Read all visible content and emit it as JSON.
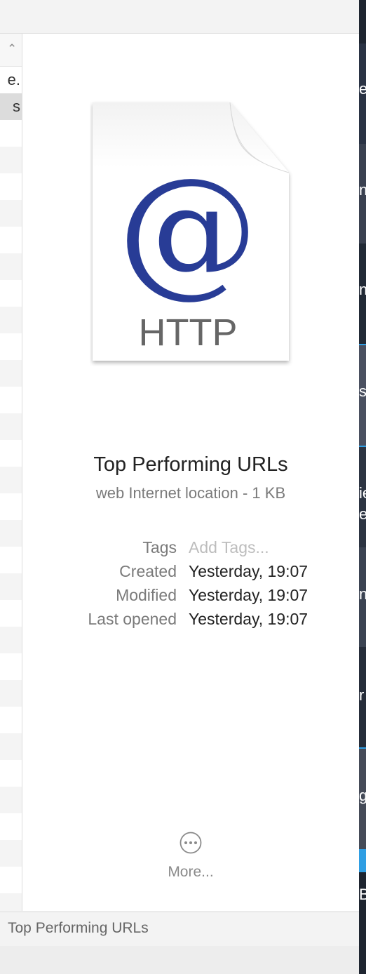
{
  "file": {
    "name": "Top Performing URLs",
    "kind_size": "web Internet location - 1 KB",
    "icon_text": "HTTP",
    "icon_symbol": "@"
  },
  "metadata": [
    {
      "label": "Tags",
      "value": "Add Tags...",
      "placeholder": true
    },
    {
      "label": "Created",
      "value": "Yesterday, 19:07",
      "placeholder": false
    },
    {
      "label": "Modified",
      "value": "Yesterday, 19:07",
      "placeholder": false
    },
    {
      "label": "Last opened",
      "value": "Yesterday, 19:07",
      "placeholder": false
    }
  ],
  "more_button": {
    "label": "More...",
    "icon": "ellipsis-circle-icon"
  },
  "path_bar": {
    "text": "Top Performing URLs"
  },
  "list": {
    "sort_icon": "chevron-up-icon",
    "visible_fragments": [
      "e.",
      "s"
    ]
  },
  "background_fragments": [
    "e",
    "nt",
    "ns",
    "s",
    "ie",
    "er",
    "n",
    "r",
    "g",
    "Bi"
  ],
  "colors": {
    "at_symbol": "#283c96",
    "selected_row": "#dcdcdc",
    "background_strip": "#1e2530",
    "accent_blue": "#2f9ee3"
  }
}
